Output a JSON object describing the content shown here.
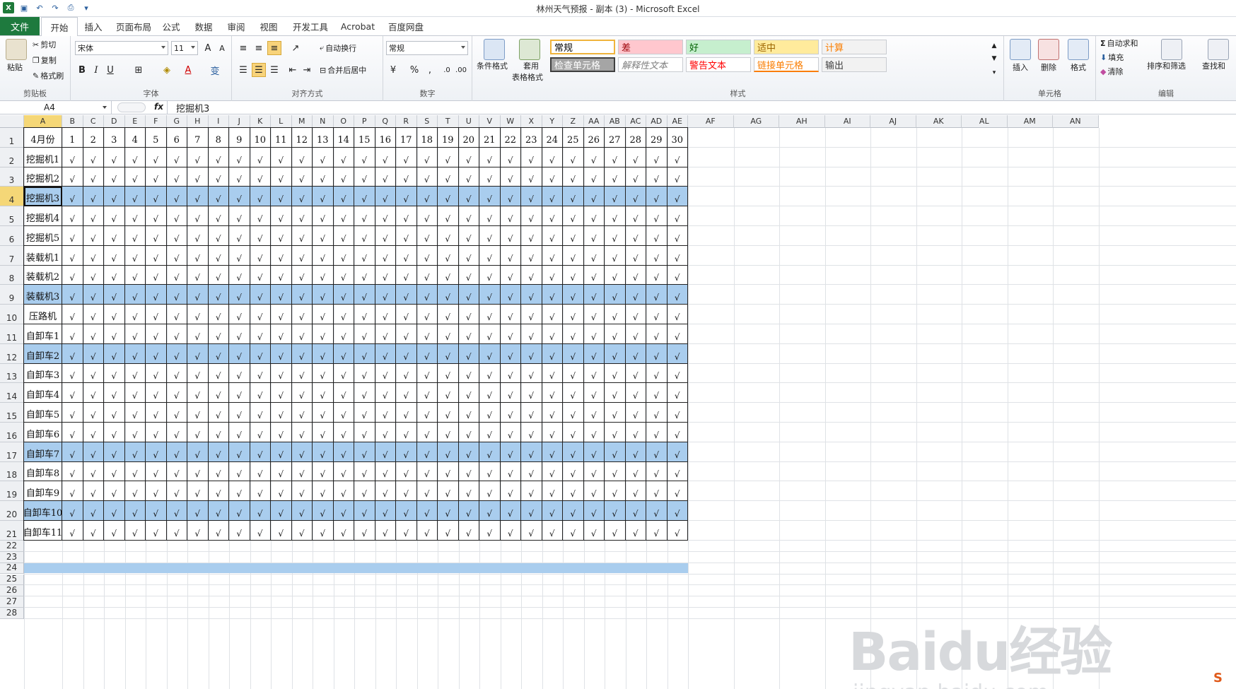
{
  "window": {
    "title": "林州天气预报 - 副本 (3)  -  Microsoft Excel"
  },
  "tabs": {
    "file": "文件",
    "items": [
      "开始",
      "插入",
      "页面布局",
      "公式",
      "数据",
      "审阅",
      "视图",
      "开发工具",
      "Acrobat",
      "百度网盘"
    ],
    "active": "开始"
  },
  "ribbon": {
    "clipboard": {
      "label": "剪贴板",
      "paste": "粘贴",
      "cut": "剪切",
      "copy": "复制",
      "format_painter": "格式刷"
    },
    "font": {
      "label": "字体",
      "name": "宋体",
      "size": "11"
    },
    "alignment": {
      "label": "对齐方式",
      "wrap": "自动换行",
      "merge": "合并后居中"
    },
    "number": {
      "label": "数字",
      "format": "常规",
      "percent": "%",
      "comma": ","
    },
    "styles": {
      "label": "样式",
      "conditional": "条件格式",
      "table_fmt_1": "套用",
      "table_fmt_2": "表格格式",
      "cells": [
        {
          "text": "常规",
          "bg": "#ffffff",
          "color": "#000000"
        },
        {
          "text": "差",
          "bg": "#ffc7ce",
          "color": "#9c0006"
        },
        {
          "text": "好",
          "bg": "#c6efce",
          "color": "#006100"
        },
        {
          "text": "适中",
          "bg": "#ffeb9c",
          "color": "#9c6500"
        },
        {
          "text": "计算",
          "bg": "#f2f2f2",
          "color": "#fa7d00"
        },
        {
          "text": "检查单元格",
          "bg": "#a5a5a5",
          "color": "#ffffff"
        },
        {
          "text": "解释性文本",
          "bg": "#ffffff",
          "color": "#7f7f7f"
        },
        {
          "text": "警告文本",
          "bg": "#ffffff",
          "color": "#ff0000"
        },
        {
          "text": "链接单元格",
          "bg": "#ffffff",
          "color": "#fa7d00"
        },
        {
          "text": "输出",
          "bg": "#f2f2f2",
          "color": "#3f3f3f"
        }
      ]
    },
    "cells": {
      "label": "单元格",
      "insert": "插入",
      "delete": "删除",
      "format": "格式"
    },
    "editing": {
      "label": "编辑",
      "autosum": "自动求和",
      "fill": "填充",
      "clear": "清除",
      "sort_filter": "排序和筛选",
      "find_select": "查找和"
    }
  },
  "formula_bar": {
    "name_box": "A4",
    "fx": "fx",
    "content": "挖掘机3"
  },
  "sheet": {
    "columns": [
      "A",
      "B",
      "C",
      "D",
      "E",
      "F",
      "G",
      "H",
      "I",
      "J",
      "K",
      "L",
      "M",
      "N",
      "O",
      "P",
      "Q",
      "R",
      "S",
      "T",
      "U",
      "V",
      "W",
      "X",
      "Y",
      "Z",
      "AA",
      "AB",
      "AC",
      "AD",
      "AE",
      "AF",
      "AG",
      "AH",
      "AI",
      "AJ",
      "AK",
      "AL",
      "AM",
      "AN"
    ],
    "row_numbers": [
      "1",
      "2",
      "3",
      "4",
      "5",
      "6",
      "7",
      "8",
      "9",
      "10",
      "11",
      "12",
      "13",
      "14",
      "15",
      "16",
      "17",
      "18",
      "19",
      "20",
      "21",
      "22",
      "23",
      "24",
      "25",
      "26",
      "27",
      "28"
    ],
    "header_row": [
      "4月份",
      "1",
      "2",
      "3",
      "4",
      "5",
      "6",
      "7",
      "8",
      "9",
      "10",
      "11",
      "12",
      "13",
      "14",
      "15",
      "16",
      "17",
      "18",
      "19",
      "20",
      "21",
      "22",
      "23",
      "24",
      "25",
      "26",
      "27",
      "28",
      "29",
      "30"
    ],
    "row_labels": [
      "挖掘机1",
      "挖掘机2",
      "挖掘机3",
      "挖掘机4",
      "挖掘机5",
      "装载机1",
      "装载机2",
      "装载机3",
      "压路机",
      "自卸车1",
      "自卸车2",
      "自卸车3",
      "自卸车4",
      "自卸车5",
      "自卸车6",
      "自卸车7",
      "自卸车8",
      "自卸车9",
      "自卸车10",
      "自卸车11"
    ],
    "check_mark": "√",
    "highlighted_rows": [
      4,
      9,
      12,
      17,
      20,
      24
    ],
    "selected_row": 4,
    "highlight_color": "#a9cdee"
  },
  "watermark": {
    "main": "Baidu经验",
    "sub": "jingyan.baidu.com"
  }
}
